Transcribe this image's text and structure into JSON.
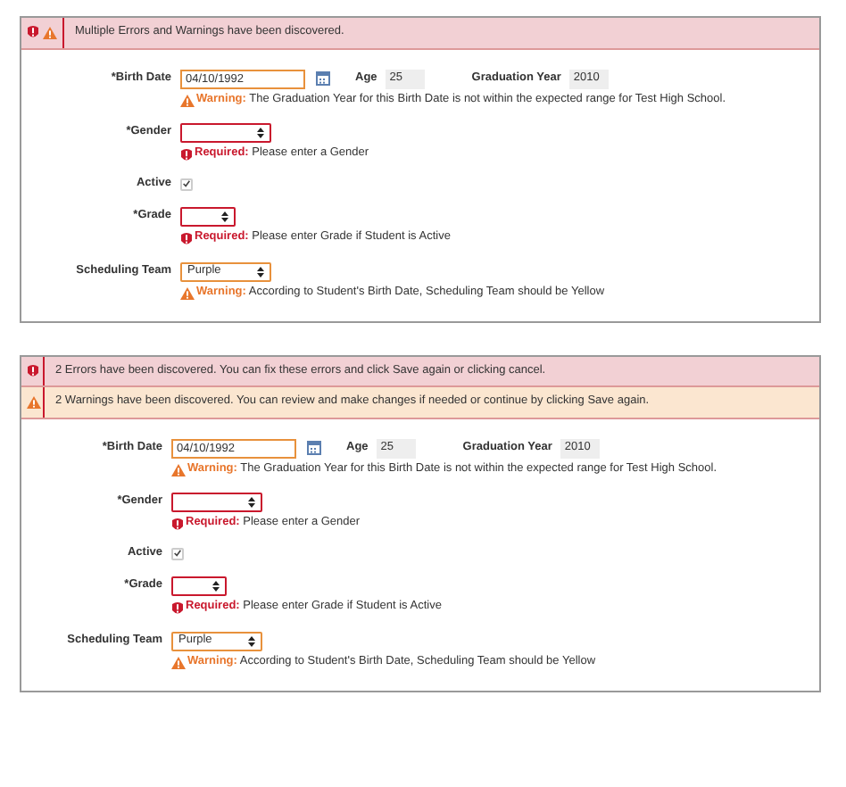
{
  "panels": [
    {
      "alerts": [
        {
          "kind": "mixed",
          "text": "Multiple Errors and Warnings have been discovered."
        }
      ],
      "fields": [
        {
          "kind": "date",
          "label": "*Birth Date",
          "value": "04/10/1992",
          "age_label": "Age",
          "age_value": "25",
          "grad_label": "Graduation Year",
          "grad_value": "2010",
          "message": {
            "kind": "warning",
            "prefix": "Warning:",
            "text": "The Graduation Year for this Birth Date is not within the expected range for Test High School."
          }
        },
        {
          "kind": "select",
          "label": "*Gender",
          "message": {
            "kind": "error",
            "prefix": "Required:",
            "text": "Please enter a Gender"
          }
        },
        {
          "kind": "checkbox",
          "label": "Active",
          "checked": true
        },
        {
          "kind": "select",
          "label": "*Grade",
          "message": {
            "kind": "error",
            "prefix": "Required:",
            "text": "Please enter Grade if Student is Active"
          }
        },
        {
          "kind": "select",
          "label": "Scheduling Team",
          "value": "Purple",
          "message": {
            "kind": "warning",
            "prefix": "Warning:",
            "text": "According to Student's Birth Date, Scheduling Team should be Yellow"
          }
        }
      ]
    },
    {
      "alerts": [
        {
          "kind": "error",
          "text": "2 Errors have been discovered. You can fix these errors and click Save again or clicking cancel."
        },
        {
          "kind": "warning",
          "text": "2 Warnings have been discovered. You can review and make changes if needed or continue by clicking Save again."
        }
      ],
      "fields": [
        {
          "kind": "date",
          "label": "*Birth Date",
          "value": "04/10/1992",
          "age_label": "Age",
          "age_value": "25",
          "grad_label": "Graduation Year",
          "grad_value": "2010",
          "message": {
            "kind": "warning",
            "prefix": "Warning:",
            "text": "The Graduation Year for this Birth Date is not within the expected range for Test High School."
          }
        },
        {
          "kind": "select",
          "label": "*Gender",
          "message": {
            "kind": "error",
            "prefix": "Required:",
            "text": "Please enter a Gender"
          }
        },
        {
          "kind": "checkbox",
          "label": "Active",
          "checked": true
        },
        {
          "kind": "select",
          "label": "*Grade",
          "message": {
            "kind": "error",
            "prefix": "Required:",
            "text": "Please enter Grade if Student is Active"
          }
        },
        {
          "kind": "select",
          "label": "Scheduling Team",
          "value": "Purple",
          "message": {
            "kind": "warning",
            "prefix": "Warning:",
            "text": "According to Student's Birth Date, Scheduling Team should be Yellow"
          }
        }
      ]
    }
  ]
}
